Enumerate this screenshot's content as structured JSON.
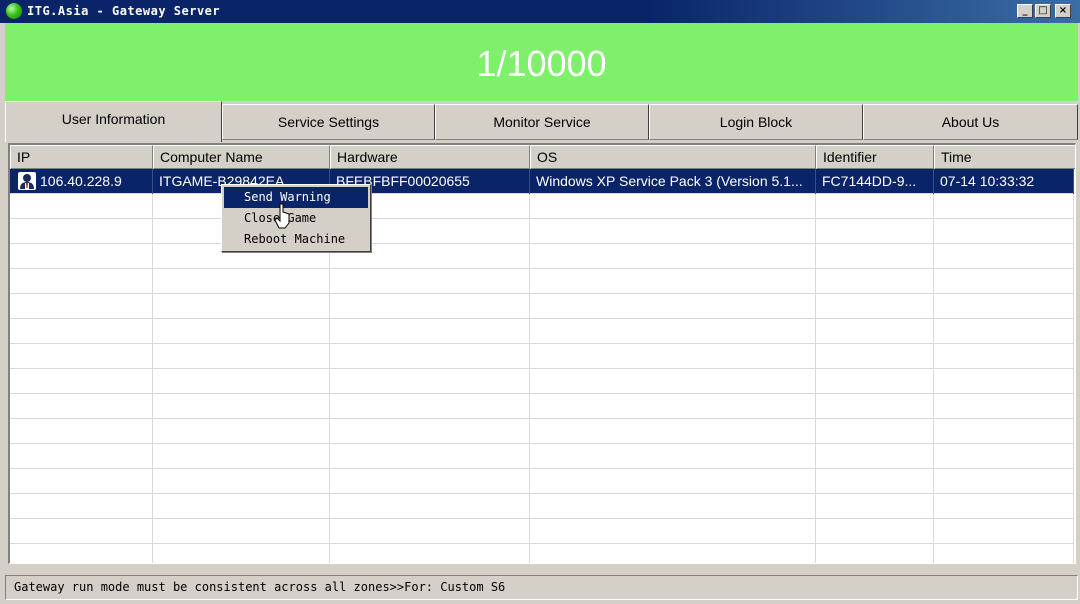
{
  "window": {
    "title": "ITG.Asia - Gateway Server",
    "app_icon": "green-orb-icon",
    "controls": {
      "minimize": "_",
      "maximize": "□",
      "close": "×"
    }
  },
  "counter": {
    "value": "1/10000",
    "background": "#7ef06c"
  },
  "tabs": [
    {
      "label": "User Information",
      "active": true
    },
    {
      "label": "Service Settings",
      "active": false
    },
    {
      "label": "Monitor Service",
      "active": false
    },
    {
      "label": "Login Block",
      "active": false
    },
    {
      "label": "About Us",
      "active": false
    }
  ],
  "table": {
    "columns": [
      "IP",
      "Computer Name",
      "Hardware",
      "OS",
      "Identifier",
      "Time"
    ],
    "rows": [
      {
        "icon": "user-icon",
        "ip": "106.40.228.9",
        "computer_name": "ITGAME-B29842EA",
        "hardware": "BFEBFBFF00020655",
        "os": "Windows XP Service Pack 3 (Version 5.1...",
        "identifier": "FC7144DD-9...",
        "time": "07-14 10:33:32",
        "selected": true
      }
    ]
  },
  "context_menu": {
    "items": [
      {
        "label": "Send Warning",
        "highlighted": true
      },
      {
        "label": "Close Game",
        "highlighted": false
      },
      {
        "label": "Reboot Machine",
        "highlighted": false
      }
    ]
  },
  "status_bar": {
    "text": "Gateway run mode must be consistent across all zones>>For: Custom S6"
  },
  "colors": {
    "selection": "#0a246a",
    "titlebar": "#0a246a",
    "chrome": "#d4d0c8"
  }
}
